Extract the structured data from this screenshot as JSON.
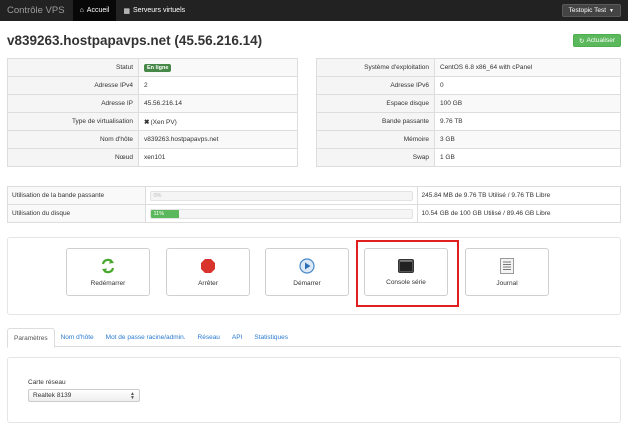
{
  "nav": {
    "brand": "Contrôle VPS",
    "links": [
      {
        "label": "Accueil",
        "icon": "home-icon",
        "glyph": "⌂"
      },
      {
        "label": "Serveurs virtuels",
        "icon": "grid-icon",
        "glyph": "▦"
      }
    ],
    "user": "Testopic Test"
  },
  "page": {
    "title": "v839263.hostpapavps.net (45.56.216.14)",
    "refresh_label": "Actualiser"
  },
  "info_left": [
    {
      "key": "Statut",
      "value": "En ligne",
      "badge": true
    },
    {
      "key": "Adresse IPv4",
      "value": "2"
    },
    {
      "key": "Adresse IP",
      "value": "45.56.216.14"
    },
    {
      "key": "Type de virtualisation",
      "value": "(Xen PV)",
      "icon": "xen-icon"
    },
    {
      "key": "Nom d'hôte",
      "value": "v839263.hostpapavps.net"
    },
    {
      "key": "Nœud",
      "value": "xen101"
    }
  ],
  "info_right": [
    {
      "key": "Système d'exploitation",
      "value": "CentOS 6.8 x86_64 with cPanel"
    },
    {
      "key": "Adresse IPv6",
      "value": "0"
    },
    {
      "key": "Espace disque",
      "value": "100 GB"
    },
    {
      "key": "Bande passante",
      "value": "9.76 TB"
    },
    {
      "key": "Mémoire",
      "value": "3 GB"
    },
    {
      "key": "Swap",
      "value": "1 GB"
    }
  ],
  "usage": [
    {
      "label": "Utilisation de la bande passante",
      "percent": 0,
      "percent_label": "0%",
      "detail": "245.84 MB de 9.76 TB Utilisé / 9.76 TB Libre"
    },
    {
      "label": "Utilisation du disque",
      "percent": 11,
      "percent_label": "11%",
      "detail": "10.54 GB de 100 GB Utilisé / 89.46 GB Libre"
    }
  ],
  "actions": [
    {
      "label": "Redémarrer",
      "icon": "restart-icon"
    },
    {
      "label": "Arrêter",
      "icon": "stop-icon"
    },
    {
      "label": "Démarrer",
      "icon": "play-icon"
    },
    {
      "label": "Console série",
      "icon": "console-icon"
    },
    {
      "label": "Journal",
      "icon": "log-icon"
    }
  ],
  "tabs": [
    "Paramètres",
    "Nom d'hôte",
    "Mot de passe racine/admin.",
    "Réseau",
    "API",
    "Statistiques"
  ],
  "active_tab": 0,
  "settings": {
    "network_card_label": "Carte réseau",
    "network_card_value": "Realtek 8139"
  },
  "colors": {
    "navbar": "#222222",
    "success": "#5cb85c",
    "highlight": "#e01f1f",
    "link": "#2a7ad0"
  }
}
